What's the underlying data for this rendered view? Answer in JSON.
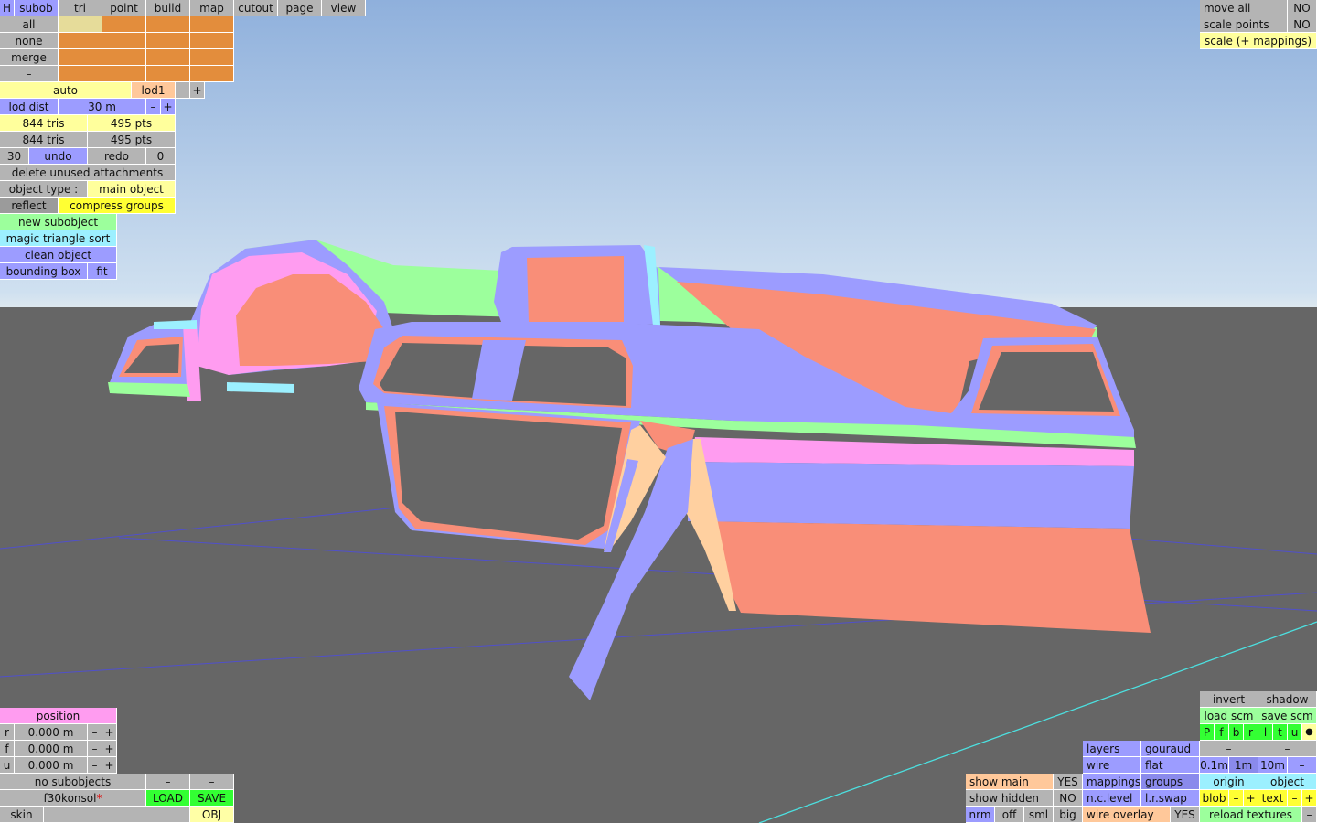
{
  "tabs": {
    "h": "H",
    "subob": "subob",
    "tri": "tri",
    "point": "point",
    "build": "build",
    "map": "map",
    "cutout": "cutout",
    "page": "page",
    "view": "view"
  },
  "groups": {
    "all": "all",
    "none": "none",
    "merge": "merge",
    "minus": "–"
  },
  "lod": {
    "auto": "auto",
    "lod1": "lod1",
    "minus": "–",
    "plus": "+",
    "dist_label": "lod dist",
    "dist_value": "30 m"
  },
  "stats": {
    "tris1": "844 tris",
    "pts1": "495 pts",
    "tris2": "844 tris",
    "pts2": "495 pts"
  },
  "history": {
    "count": "30",
    "undo": "undo",
    "redo": "redo",
    "redo_count": "0"
  },
  "actions": {
    "delete_unused": "delete unused attachments",
    "object_type_label": "object type :",
    "object_type_value": "main object",
    "reflect": "reflect",
    "compress_groups": "compress groups",
    "new_subobject": "new subobject",
    "magic_sort": "magic triangle sort",
    "clean_object": "clean object",
    "bounding_box": "bounding box",
    "fit": "fit"
  },
  "top_right": {
    "move_all": "move all",
    "move_all_val": "NO",
    "scale_points": "scale points",
    "scale_points_val": "NO",
    "scale_mappings": "scale (+ mappings)"
  },
  "position": {
    "title": "position",
    "rows": [
      {
        "axis": "r",
        "value": "0.000 m"
      },
      {
        "axis": "f",
        "value": "0.000 m"
      },
      {
        "axis": "u",
        "value": "0.000 m"
      }
    ],
    "minus": "–",
    "plus": "+"
  },
  "file": {
    "subobjects": "no subobjects",
    "dash1": "–",
    "dash2": "–",
    "filename": "f30konsol",
    "modified_mark": "*",
    "load": "LOAD",
    "save": "SAVE",
    "skin": "skin",
    "obj": "OBJ"
  },
  "view_opts": {
    "show_main": "show main",
    "show_main_val": "YES",
    "show_hidden": "show hidden",
    "show_hidden_val": "NO",
    "nrm": "nrm",
    "off": "off",
    "sml": "sml",
    "big": "big",
    "layers": "layers",
    "gouraud": "gouraud",
    "wire": "wire",
    "flat": "flat",
    "mappings": "mappings",
    "groups": "groups",
    "nc_level": "n.c.level",
    "lr_swap": "l.r.swap",
    "wire_overlay": "wire overlay",
    "wire_overlay_val": "YES"
  },
  "br": {
    "invert": "invert",
    "shadow": "shadow",
    "load_scm": "load scm",
    "save_scm": "save scm",
    "letters": [
      "P",
      "f",
      "b",
      "r",
      "l",
      "t",
      "u"
    ],
    "dot": "●",
    "dash1": "–",
    "dash2": "–",
    "s01": "0.1m",
    "s1": "1m",
    "s10": "10m",
    "sdash": "–",
    "origin": "origin",
    "object": "object",
    "blob": "blob",
    "minus": "–",
    "plus": "+",
    "text": "text",
    "reload": "reload textures",
    "reload_minus": "–"
  },
  "colors": {
    "blue": "#9c9cff",
    "salmon": "#f98e78",
    "pink": "#ff9cf0",
    "green": "#9cff9c",
    "cyan": "#9cf0ff",
    "peach": "#ffd0a0",
    "ground": "#666666"
  }
}
